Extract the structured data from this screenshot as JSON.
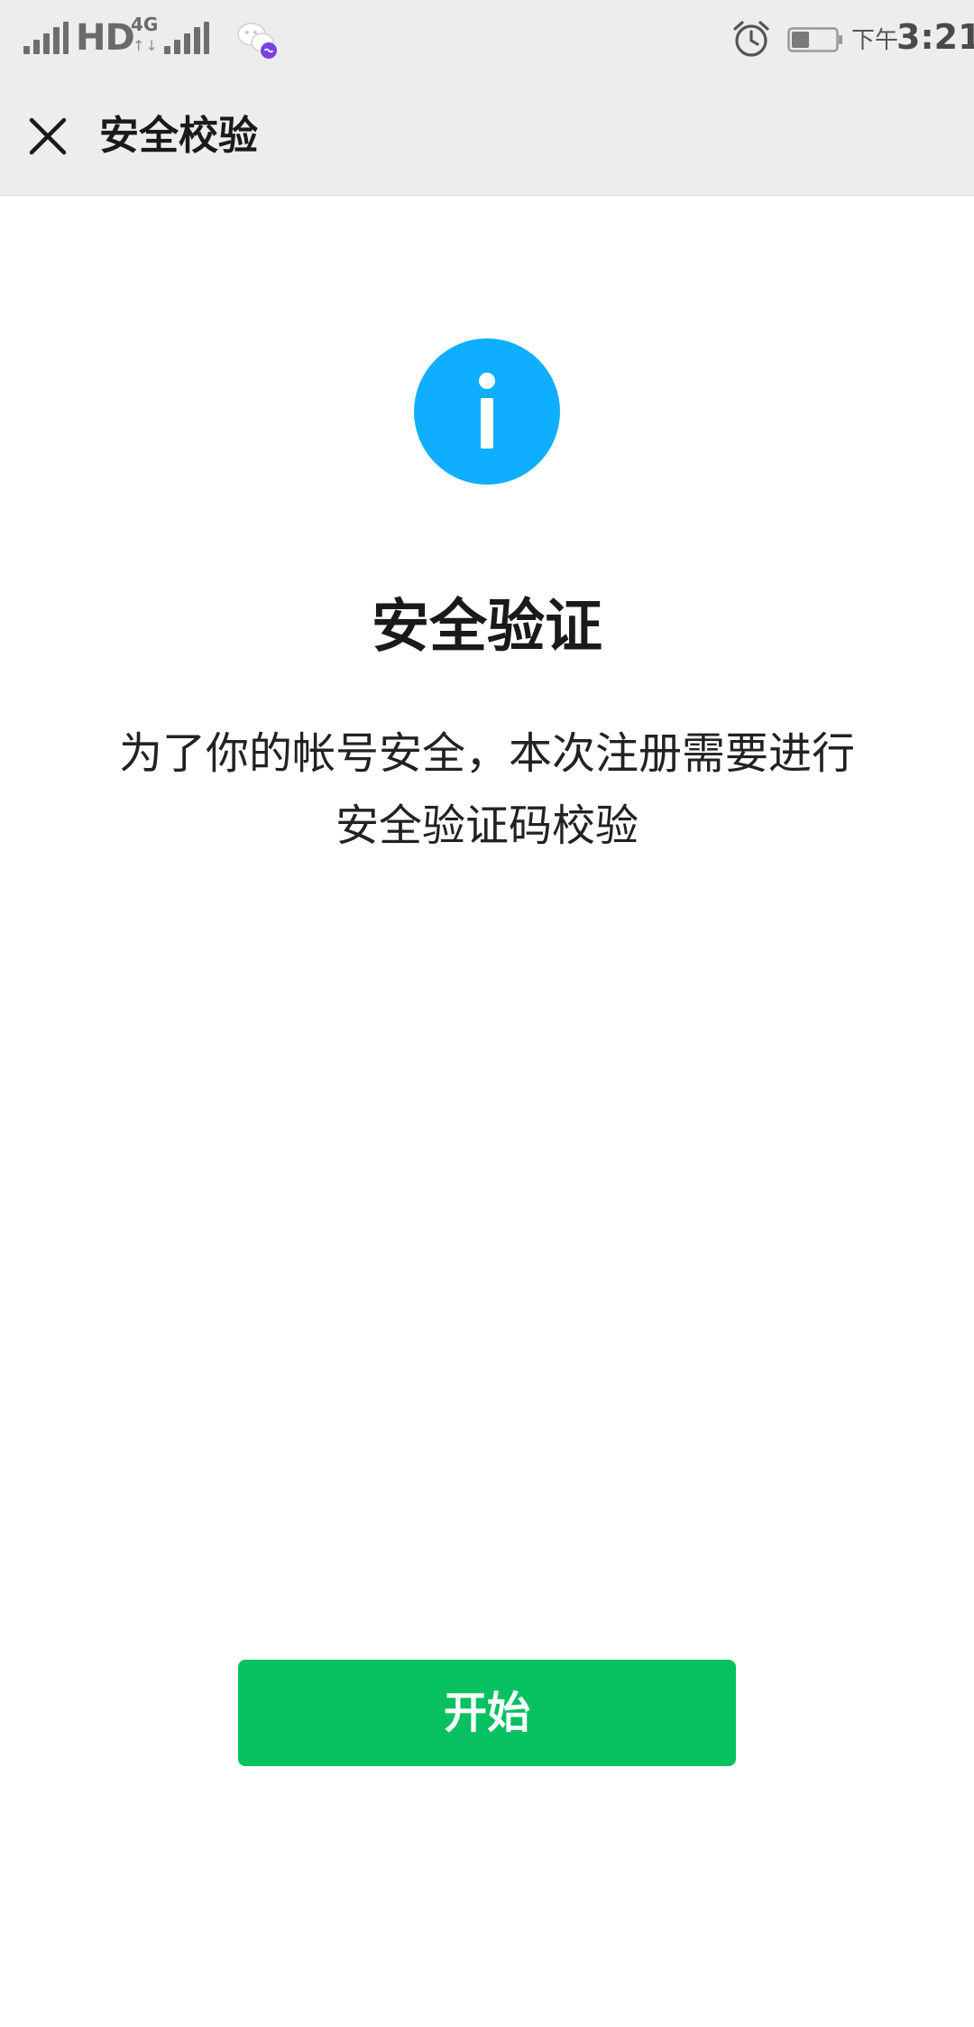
{
  "status_bar": {
    "network_type": "HD",
    "network_gen": "4G",
    "data_arrows": "↑↓",
    "period": "下午",
    "time": "3:21",
    "icons": [
      "signal-icon",
      "wechat-icon",
      "alarm-icon",
      "battery-icon"
    ]
  },
  "nav": {
    "title": "安全校验",
    "close_icon": "close-icon"
  },
  "content": {
    "icon": "info-icon",
    "icon_color": "#10aeff",
    "title": "安全验证",
    "description_line1": "为了你的帐号安全，本次注册需要进行",
    "description_line2": "安全验证码校验"
  },
  "actions": {
    "start_label": "开始",
    "accent_color": "#07c160"
  }
}
